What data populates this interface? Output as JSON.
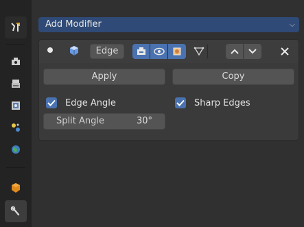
{
  "sidebar": {
    "tabs": [
      {
        "name": "tool-icon"
      },
      {
        "name": "render-icon"
      },
      {
        "name": "output-icon"
      },
      {
        "name": "view-layer-icon"
      },
      {
        "name": "scene-icon"
      },
      {
        "name": "world-icon"
      },
      {
        "name": "object-icon"
      },
      {
        "name": "modifier-wrench-icon",
        "active": true
      }
    ]
  },
  "add_modifier": {
    "label": "Add Modifier"
  },
  "modifier": {
    "name": "Edge",
    "apply_label": "Apply",
    "copy_label": "Copy",
    "edge_angle": {
      "label": "Edge Angle",
      "checked": true
    },
    "sharp_edges": {
      "label": "Sharp Edges",
      "checked": true
    },
    "split_angle": {
      "label": "Split Angle",
      "value": "30°"
    }
  },
  "colors": {
    "accent": "#4a72b0",
    "header_blue": "#2f4a76"
  }
}
